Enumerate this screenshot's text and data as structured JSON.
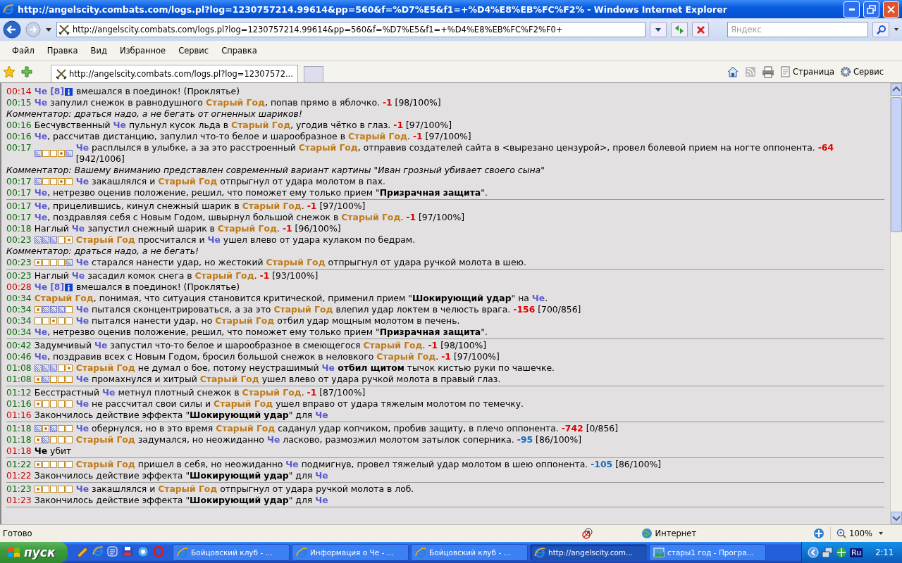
{
  "window": {
    "title": "http://angelscity.combats.com/logs.pl?log=1230757214.99614&pp=560&f=%D7%E5&f1=+%D4%E8%EB%FC%F2% - Windows Internet Explorer"
  },
  "nav": {
    "address": "http://angelscity.combats.com/logs.pl?log=1230757214.99614&pp=560&f=%D7%E5&f1=+%D4%E8%EB%FC%F2%F0+",
    "search_placeholder": "Яндекс"
  },
  "menu": [
    "Файл",
    "Правка",
    "Вид",
    "Избранное",
    "Сервис",
    "Справка"
  ],
  "tabs": [
    {
      "label": "http://angelscity.combats.com/logs.pl?log=12307572...",
      "selected": true
    }
  ],
  "command_bar": [
    "Страница",
    "Сервис"
  ],
  "log": {
    "groups": [
      {
        "lines": [
          {
            "time": "00:14",
            "alert": true,
            "segments": [
              {
                "kind": "me",
                "text": "Че"
              },
              {
                "kind": "level",
                "text": "[8]"
              },
              {
                "kind": "info"
              },
              {
                "kind": "text",
                "text": " вмешался в поединок! (Проклятье)"
              }
            ]
          },
          {
            "time": "00:15",
            "alert": false,
            "segments": [
              {
                "kind": "me",
                "text": "Че"
              },
              {
                "kind": "text",
                "text": " запулил снежок в равнодушного "
              },
              {
                "kind": "foe",
                "text": "Старый Год"
              },
              {
                "kind": "text",
                "text": ", попав прямо в яблочко. "
              },
              {
                "kind": "damage",
                "text": "-1"
              },
              {
                "kind": "text",
                "text": " [98/100%]"
              }
            ]
          },
          {
            "comment": "Комментатор: драться надо, а не бегать от огненных шариков!"
          },
          {
            "time": "00:16",
            "alert": false,
            "segments": [
              {
                "kind": "text",
                "text": "Бесчувственный "
              },
              {
                "kind": "me",
                "text": "Че"
              },
              {
                "kind": "text",
                "text": " пульнул кусок льда в "
              },
              {
                "kind": "foe",
                "text": "Старый Год"
              },
              {
                "kind": "text",
                "text": ", угодив чётко в глаз. "
              },
              {
                "kind": "damage",
                "text": "-1"
              },
              {
                "kind": "text",
                "text": " [97/100%]"
              }
            ]
          },
          {
            "time": "00:16",
            "alert": false,
            "segments": [
              {
                "kind": "me",
                "text": "Че"
              },
              {
                "kind": "text",
                "text": ", рассчитав дистанцию, запулил что-то белое и шарообразное в "
              },
              {
                "kind": "foe",
                "text": "Старый Год"
              },
              {
                "kind": "text",
                "text": ". "
              },
              {
                "kind": "damage",
                "text": "-1"
              },
              {
                "kind": "text",
                "text": " [97/100%]"
              }
            ]
          },
          {
            "time": "00:17",
            "alert": false,
            "segments": [
              {
                "kind": "zones",
                "cells": [
                  {
                    "hatched": true,
                    "dot": false
                  },
                  {
                    "hatched": false,
                    "dot": false
                  },
                  {
                    "hatched": false,
                    "dot": false
                  },
                  {
                    "hatched": false,
                    "dot": true
                  },
                  {
                    "hatched": true,
                    "dot": false
                  }
                ]
              },
              {
                "kind": "me",
                "text": "Че"
              },
              {
                "kind": "text",
                "text": " расплылся в улыбке, а за это расстроенный "
              },
              {
                "kind": "foe",
                "text": "Старый Год"
              },
              {
                "kind": "text",
                "text": ", отправив создателей сайта в <вырезано цензурой>, провел болевой прием на ногте оппонента. "
              },
              {
                "kind": "damage",
                "text": "-64"
              },
              {
                "kind": "text",
                "text": " [942/1006]"
              }
            ]
          },
          {
            "comment": "Комментатор: Вашему вниманию представлен современный вариант картины \"Иван грозный убивает своего сына\""
          },
          {
            "time": "00:17",
            "alert": false,
            "segments": [
              {
                "kind": "zones",
                "cells": [
                  {
                    "hatched": true,
                    "dot": false
                  },
                  {
                    "hatched": false,
                    "dot": false
                  },
                  {
                    "hatched": false,
                    "dot": false
                  },
                  {
                    "hatched": false,
                    "dot": true
                  },
                  {
                    "hatched": false,
                    "dot": false
                  }
                ]
              },
              {
                "kind": "me",
                "text": "Че"
              },
              {
                "kind": "text",
                "text": " закашлялся и "
              },
              {
                "kind": "foe",
                "text": "Старый Год"
              },
              {
                "kind": "text",
                "text": " отпрыгнул от удара молотом в пах."
              }
            ]
          },
          {
            "time": "00:17",
            "alert": false,
            "segments": [
              {
                "kind": "me",
                "text": "Че"
              },
              {
                "kind": "text",
                "text": ", нетрезво оценив положение, решил, что поможет ему только прием \""
              },
              {
                "kind": "bold",
                "text": "Призрачная защита"
              },
              {
                "kind": "text",
                "text": "\"."
              }
            ]
          }
        ]
      },
      {
        "lines": [
          {
            "time": "00:17",
            "alert": false,
            "segments": [
              {
                "kind": "me",
                "text": "Че"
              },
              {
                "kind": "text",
                "text": ", прицелившись, кинул снежный шарик в "
              },
              {
                "kind": "foe",
                "text": "Старый Год"
              },
              {
                "kind": "text",
                "text": ". "
              },
              {
                "kind": "damage",
                "text": "-1"
              },
              {
                "kind": "text",
                "text": " [97/100%]"
              }
            ]
          },
          {
            "time": "00:17",
            "alert": false,
            "segments": [
              {
                "kind": "me",
                "text": "Че"
              },
              {
                "kind": "text",
                "text": ", поздравляя себя с Новым Годом, швырнул большой снежок в "
              },
              {
                "kind": "foe",
                "text": "Старый Год"
              },
              {
                "kind": "text",
                "text": ". "
              },
              {
                "kind": "damage",
                "text": "-1"
              },
              {
                "kind": "text",
                "text": " [97/100%]"
              }
            ]
          },
          {
            "time": "00:18",
            "alert": false,
            "segments": [
              {
                "kind": "text",
                "text": "Наглый "
              },
              {
                "kind": "me",
                "text": "Че"
              },
              {
                "kind": "text",
                "text": " запустил снежный шарик в "
              },
              {
                "kind": "foe",
                "text": "Старый Год"
              },
              {
                "kind": "text",
                "text": ". "
              },
              {
                "kind": "damage",
                "text": "-1"
              },
              {
                "kind": "text",
                "text": " [96/100%]"
              }
            ]
          },
          {
            "time": "00:23",
            "alert": false,
            "segments": [
              {
                "kind": "zones",
                "cells": [
                  {
                    "hatched": true,
                    "dot": false
                  },
                  {
                    "hatched": true,
                    "dot": false
                  },
                  {
                    "hatched": true,
                    "dot": false
                  },
                  {
                    "hatched": false,
                    "dot": false
                  },
                  {
                    "hatched": false,
                    "dot": true
                  }
                ]
              },
              {
                "kind": "foe",
                "text": "Старый Год"
              },
              {
                "kind": "text",
                "text": " просчитался и "
              },
              {
                "kind": "me",
                "text": "Че"
              },
              {
                "kind": "text",
                "text": " ушел влево от удара кулаком по бедрам."
              }
            ]
          },
          {
            "comment": "Комментатор: драться надо, а не бегать!"
          },
          {
            "time": "00:23",
            "alert": false,
            "segments": [
              {
                "kind": "zones",
                "cells": [
                  {
                    "hatched": false,
                    "dot": true
                  },
                  {
                    "hatched": false,
                    "dot": false
                  },
                  {
                    "hatched": false,
                    "dot": false
                  },
                  {
                    "hatched": false,
                    "dot": false
                  },
                  {
                    "hatched": true,
                    "dot": false
                  }
                ]
              },
              {
                "kind": "me",
                "text": "Че"
              },
              {
                "kind": "text",
                "text": " старался нанести удар, но жестокий "
              },
              {
                "kind": "foe",
                "text": "Старый Год"
              },
              {
                "kind": "text",
                "text": " отпрыгнул от удара ручкой молота в шею."
              }
            ]
          }
        ]
      },
      {
        "lines": [
          {
            "time": "00:23",
            "alert": false,
            "segments": [
              {
                "kind": "text",
                "text": "Наглый "
              },
              {
                "kind": "me",
                "text": "Че"
              },
              {
                "kind": "text",
                "text": " засадил комок снега в "
              },
              {
                "kind": "foe",
                "text": "Старый Год"
              },
              {
                "kind": "text",
                "text": ". "
              },
              {
                "kind": "damage",
                "text": "-1"
              },
              {
                "kind": "text",
                "text": " [93/100%]"
              }
            ]
          },
          {
            "time": "00:28",
            "alert": true,
            "segments": [
              {
                "kind": "me",
                "text": "Че"
              },
              {
                "kind": "level",
                "text": "[8]"
              },
              {
                "kind": "info"
              },
              {
                "kind": "text",
                "text": " вмешался в поединок! (Проклятье)"
              }
            ]
          },
          {
            "time": "00:34",
            "alert": false,
            "segments": [
              {
                "kind": "foe",
                "text": "Старый Год"
              },
              {
                "kind": "text",
                "text": ", понимая, что ситуация становится критической, применил прием \""
              },
              {
                "kind": "bold",
                "text": "Шокирующий удар"
              },
              {
                "kind": "text",
                "text": "\" на "
              },
              {
                "kind": "me",
                "text": "Че"
              },
              {
                "kind": "text",
                "text": "."
              }
            ]
          },
          {
            "time": "00:34",
            "alert": false,
            "segments": [
              {
                "kind": "zones",
                "cells": [
                  {
                    "hatched": false,
                    "dot": true
                  },
                  {
                    "hatched": true,
                    "dot": false
                  },
                  {
                    "hatched": true,
                    "dot": false
                  },
                  {
                    "hatched": true,
                    "dot": false
                  },
                  {
                    "hatched": false,
                    "dot": false
                  }
                ]
              },
              {
                "kind": "me",
                "text": "Че"
              },
              {
                "kind": "text",
                "text": " пытался сконцентрироваться, а за это "
              },
              {
                "kind": "foe",
                "text": "Старый Год"
              },
              {
                "kind": "text",
                "text": " влепил удар локтем в челюсть врага. "
              },
              {
                "kind": "damage",
                "text": "-156"
              },
              {
                "kind": "text",
                "text": " [700/856]"
              }
            ]
          },
          {
            "time": "00:34",
            "alert": false,
            "segments": [
              {
                "kind": "zones",
                "cells": [
                  {
                    "hatched": false,
                    "dot": false
                  },
                  {
                    "hatched": false,
                    "dot": false
                  },
                  {
                    "hatched": false,
                    "dot": true
                  },
                  {
                    "hatched": false,
                    "dot": false
                  },
                  {
                    "hatched": false,
                    "dot": false
                  }
                ]
              },
              {
                "kind": "me",
                "text": "Че"
              },
              {
                "kind": "text",
                "text": " пытался нанести удар, но "
              },
              {
                "kind": "foe",
                "text": "Старый Год"
              },
              {
                "kind": "text",
                "text": " отбил удар мощным молотом в печень."
              }
            ]
          },
          {
            "time": "00:34",
            "alert": false,
            "segments": [
              {
                "kind": "me",
                "text": "Че"
              },
              {
                "kind": "text",
                "text": ", нетрезво оценив положение, решил, что поможет ему только прием \""
              },
              {
                "kind": "bold",
                "text": "Призрачная защита"
              },
              {
                "kind": "text",
                "text": "\"."
              }
            ]
          }
        ]
      },
      {
        "lines": [
          {
            "time": "00:42",
            "alert": false,
            "segments": [
              {
                "kind": "text",
                "text": "Задумчивый "
              },
              {
                "kind": "me",
                "text": "Че"
              },
              {
                "kind": "text",
                "text": " запустил что-то белое и шарообразное в смеющегося "
              },
              {
                "kind": "foe",
                "text": "Старый Год"
              },
              {
                "kind": "text",
                "text": ". "
              },
              {
                "kind": "damage",
                "text": "-1"
              },
              {
                "kind": "text",
                "text": " [98/100%]"
              }
            ]
          },
          {
            "time": "00:46",
            "alert": false,
            "segments": [
              {
                "kind": "me",
                "text": "Че"
              },
              {
                "kind": "text",
                "text": ", поздравив всех с Новым Годом, бросил большой снежок в неловкого "
              },
              {
                "kind": "foe",
                "text": "Старый Год"
              },
              {
                "kind": "text",
                "text": ". "
              },
              {
                "kind": "damage",
                "text": "-1"
              },
              {
                "kind": "text",
                "text": " [97/100%]"
              }
            ]
          },
          {
            "time": "01:08",
            "alert": false,
            "segments": [
              {
                "kind": "zones",
                "cells": [
                  {
                    "hatched": true,
                    "dot": false
                  },
                  {
                    "hatched": true,
                    "dot": false
                  },
                  {
                    "hatched": true,
                    "dot": false
                  },
                  {
                    "hatched": false,
                    "dot": false
                  },
                  {
                    "hatched": false,
                    "dot": true
                  }
                ]
              },
              {
                "kind": "foe",
                "text": "Старый Год"
              },
              {
                "kind": "text",
                "text": " не думал о бое, потому неустрашимый "
              },
              {
                "kind": "me",
                "text": "Че"
              },
              {
                "kind": "bold",
                "text": " отбил щитом"
              },
              {
                "kind": "text",
                "text": " тычок кистью руки по чашечке."
              }
            ]
          },
          {
            "time": "01:08",
            "alert": false,
            "segments": [
              {
                "kind": "zones",
                "cells": [
                  {
                    "hatched": false,
                    "dot": true
                  },
                  {
                    "hatched": true,
                    "dot": false
                  },
                  {
                    "hatched": false,
                    "dot": false
                  },
                  {
                    "hatched": false,
                    "dot": false
                  },
                  {
                    "hatched": false,
                    "dot": false
                  }
                ]
              },
              {
                "kind": "me",
                "text": "Че"
              },
              {
                "kind": "text",
                "text": " промахнулся и хитрый "
              },
              {
                "kind": "foe",
                "text": "Старый Год"
              },
              {
                "kind": "text",
                "text": " ушел влево от удара ручкой молота в правый глаз."
              }
            ]
          }
        ]
      },
      {
        "lines": [
          {
            "time": "01:12",
            "alert": false,
            "segments": [
              {
                "kind": "text",
                "text": "Бесстрастный "
              },
              {
                "kind": "me",
                "text": "Че"
              },
              {
                "kind": "text",
                "text": " метнул плотный снежок в "
              },
              {
                "kind": "foe",
                "text": "Старый Год"
              },
              {
                "kind": "text",
                "text": ". "
              },
              {
                "kind": "damage",
                "text": "-1"
              },
              {
                "kind": "text",
                "text": " [87/100%]"
              }
            ]
          },
          {
            "time": "01:16",
            "alert": false,
            "segments": [
              {
                "kind": "zones",
                "cells": [
                  {
                    "hatched": false,
                    "dot": true
                  },
                  {
                    "hatched": false,
                    "dot": false
                  },
                  {
                    "hatched": false,
                    "dot": false
                  },
                  {
                    "hatched": false,
                    "dot": false
                  },
                  {
                    "hatched": false,
                    "dot": false
                  }
                ]
              },
              {
                "kind": "me",
                "text": "Че"
              },
              {
                "kind": "text",
                "text": " не рассчитал свои силы и "
              },
              {
                "kind": "foe",
                "text": "Старый Год"
              },
              {
                "kind": "text",
                "text": " ушел вправо от удара тяжелым молотом по темечку."
              }
            ]
          },
          {
            "time": "01:16",
            "alert": true,
            "segments": [
              {
                "kind": "text",
                "text": "Закончилось действие эффекта \""
              },
              {
                "kind": "bold",
                "text": "Шокирующий удар"
              },
              {
                "kind": "text",
                "text": "\" для "
              },
              {
                "kind": "me",
                "text": "Че"
              }
            ]
          }
        ]
      },
      {
        "lines": [
          {
            "time": "01:18",
            "alert": false,
            "segments": [
              {
                "kind": "zones",
                "cells": [
                  {
                    "hatched": true,
                    "dot": false
                  },
                  {
                    "hatched": false,
                    "dot": true
                  },
                  {
                    "hatched": true,
                    "dot": false
                  },
                  {
                    "hatched": false,
                    "dot": false
                  },
                  {
                    "hatched": false,
                    "dot": false
                  }
                ]
              },
              {
                "kind": "me",
                "text": "Че"
              },
              {
                "kind": "text",
                "text": " обернулся, но в это время "
              },
              {
                "kind": "foe",
                "text": "Старый Год"
              },
              {
                "kind": "text",
                "text": " саданул удар копчиком, пробив защиту, в плечо оппонента. "
              },
              {
                "kind": "damage",
                "text": "-742"
              },
              {
                "kind": "text",
                "text": " [0/856]"
              }
            ]
          },
          {
            "time": "01:18",
            "alert": false,
            "segments": [
              {
                "kind": "zones",
                "cells": [
                  {
                    "hatched": false,
                    "dot": true
                  },
                  {
                    "hatched": true,
                    "dot": false
                  },
                  {
                    "hatched": false,
                    "dot": false
                  },
                  {
                    "hatched": false,
                    "dot": false
                  },
                  {
                    "hatched": false,
                    "dot": false
                  }
                ]
              },
              {
                "kind": "foe",
                "text": "Старый Год"
              },
              {
                "kind": "text",
                "text": " задумался, но неожиданно "
              },
              {
                "kind": "me",
                "text": "Че"
              },
              {
                "kind": "text",
                "text": " ласково, размозжил молотом затылок соперника. "
              },
              {
                "kind": "hit",
                "text": "-95"
              },
              {
                "kind": "text",
                "text": " [86/100%]"
              }
            ]
          },
          {
            "time": "01:18",
            "alert": true,
            "segments": [
              {
                "kind": "bold",
                "text": "Че"
              },
              {
                "kind": "text",
                "text": " убит"
              }
            ]
          }
        ]
      },
      {
        "lines": [
          {
            "time": "01:22",
            "alert": false,
            "segments": [
              {
                "kind": "zones",
                "cells": [
                  {
                    "hatched": false,
                    "dot": true
                  },
                  {
                    "hatched": false,
                    "dot": false
                  },
                  {
                    "hatched": false,
                    "dot": false
                  },
                  {
                    "hatched": false,
                    "dot": false
                  },
                  {
                    "hatched": false,
                    "dot": false
                  }
                ]
              },
              {
                "kind": "foe",
                "text": "Старый Год"
              },
              {
                "kind": "text",
                "text": " пришел в себя, но неожиданно "
              },
              {
                "kind": "me",
                "text": "Че"
              },
              {
                "kind": "text",
                "text": " подмигнув, провел тяжелый удар молотом в шею оппонента. "
              },
              {
                "kind": "hit",
                "text": "-105"
              },
              {
                "kind": "text",
                "text": " [86/100%]"
              }
            ]
          },
          {
            "time": "01:22",
            "alert": true,
            "segments": [
              {
                "kind": "text",
                "text": "Закончилось действие эффекта \""
              },
              {
                "kind": "bold",
                "text": "Шокирующий удар"
              },
              {
                "kind": "text",
                "text": "\" для "
              },
              {
                "kind": "me",
                "text": "Че"
              }
            ]
          }
        ]
      },
      {
        "lines": [
          {
            "time": "01:23",
            "alert": false,
            "segments": [
              {
                "kind": "zones",
                "cells": [
                  {
                    "hatched": false,
                    "dot": true
                  },
                  {
                    "hatched": false,
                    "dot": false
                  },
                  {
                    "hatched": false,
                    "dot": false
                  },
                  {
                    "hatched": false,
                    "dot": false
                  },
                  {
                    "hatched": false,
                    "dot": false
                  }
                ]
              },
              {
                "kind": "me",
                "text": "Че"
              },
              {
                "kind": "text",
                "text": " закашлялся и "
              },
              {
                "kind": "foe",
                "text": "Старый Год"
              },
              {
                "kind": "text",
                "text": " отпрыгнул от удара ручкой молота в лоб."
              }
            ]
          },
          {
            "time": "01:23",
            "alert": true,
            "segments": [
              {
                "kind": "text",
                "text": "Закончилось действие эффекта \""
              },
              {
                "kind": "bold",
                "text": "Шокирующий удар"
              },
              {
                "kind": "text",
                "text": "\" для "
              },
              {
                "kind": "me",
                "text": "Че"
              }
            ]
          }
        ]
      }
    ]
  },
  "status_bar": {
    "text": "Готово",
    "zone": "Интернет",
    "zoom": "100%"
  },
  "taskbar": {
    "start": "пуск",
    "windows": [
      {
        "label": "Бойцовский клуб - ...",
        "selected": false
      },
      {
        "label": "Информация о Че - ...",
        "selected": false
      },
      {
        "label": "Бойцовский клуб - ...",
        "selected": false
      },
      {
        "label": "http://angelscity.com...",
        "selected": true
      },
      {
        "label": "стары1 год - Програ...",
        "selected": false
      }
    ],
    "language": "Ru",
    "clock": "2:11"
  }
}
